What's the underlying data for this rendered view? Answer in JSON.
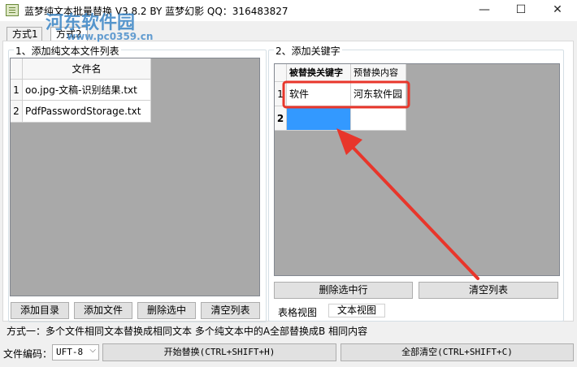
{
  "window": {
    "title": "蓝梦纯文本批量替换 V3.8.2 BY 蓝梦幻影 QQ：316483827",
    "minimize_glyph": "—",
    "maximize_glyph": "☐",
    "close_glyph": "✕"
  },
  "watermark": {
    "brand": "河东软件园",
    "url": "www.pc0359.cn"
  },
  "tabs": [
    {
      "label": "方式1"
    },
    {
      "label": "方式2"
    }
  ],
  "file_list": {
    "title": "1、添加纯文本文件列表",
    "column_header": "文件名",
    "rows": [
      {
        "index": "1",
        "name": "oo.jpg-文稿-识别结果.txt"
      },
      {
        "index": "2",
        "name": "PdfPasswordStorage.txt"
      }
    ],
    "buttons": {
      "add_dir": "添加目录",
      "add_file": "添加文件",
      "delete_selected": "删除选中",
      "clear_list": "清空列表"
    }
  },
  "keywords": {
    "title": "2、添加关键字",
    "headers": {
      "find": "被替换关键字",
      "replace": "预替换内容"
    },
    "rows": [
      {
        "index": "1",
        "find": "软件",
        "replace": "河东软件园"
      },
      {
        "index": "2",
        "find": "",
        "replace": ""
      }
    ],
    "buttons": {
      "delete_selected_row": "删除选中行",
      "clear_list": "清空列表"
    },
    "view_tabs": {
      "table_view": "表格视图",
      "text_view": "文本视图"
    }
  },
  "status_text": "方式一：多个文件相同文本替换成相同文本  多个纯文本中的A全部替换成B 相同内容",
  "footer": {
    "encoding_label": "文件编码：",
    "encoding_value": "UFT-8",
    "start_button": "开始替换(CTRL+SHIFT+H)",
    "clear_all_button": "全部清空(CTRL+SHIFT+C)"
  },
  "colors": {
    "selected_cell": "#3399ff",
    "annotation_red": "#e8362b",
    "watermark_blue": "#3b86c6"
  },
  "icons": {
    "app": "text-document-icon",
    "dropdown": "chevron-down-icon"
  }
}
